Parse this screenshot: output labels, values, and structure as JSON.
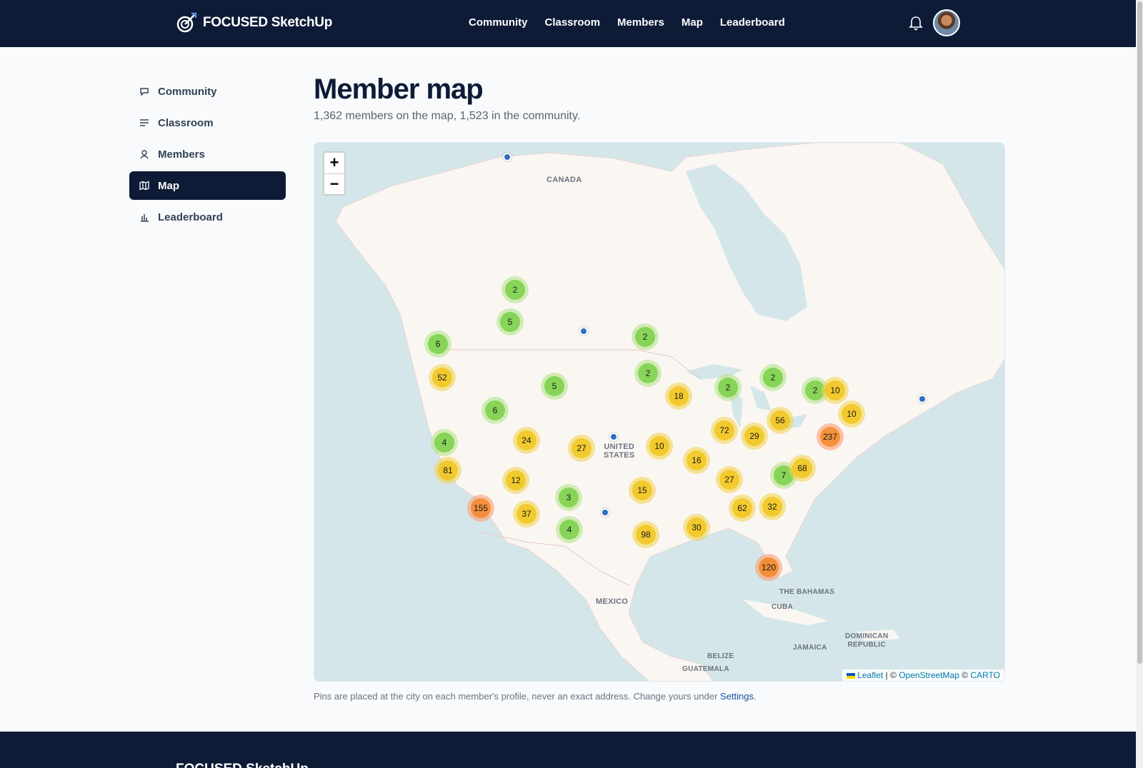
{
  "brand": {
    "name": "FOCUSED SketchUp"
  },
  "topnav": [
    "Community",
    "Classroom",
    "Members",
    "Map",
    "Leaderboard"
  ],
  "sidebar": {
    "items": [
      {
        "label": "Community",
        "icon": "chat-icon"
      },
      {
        "label": "Classroom",
        "icon": "list-icon"
      },
      {
        "label": "Members",
        "icon": "person-icon"
      },
      {
        "label": "Map",
        "icon": "map-icon",
        "active": true
      },
      {
        "label": "Leaderboard",
        "icon": "bar-chart-icon"
      }
    ]
  },
  "page": {
    "title": "Member map",
    "subtitle": "1,362 members on the map, 1,523 in the community."
  },
  "map": {
    "zoom_in": "+",
    "zoom_out": "−",
    "labels": {
      "canada": "CANADA",
      "us_line1": "UNITED",
      "us_line2": "STATES",
      "mexico": "MEXICO",
      "bahamas": "THE BAHAMAS",
      "cuba": "CUBA",
      "jamaica": "JAMAICA",
      "dr_line1": "DOMINICAN",
      "dr_line2": "REPUBLIC",
      "belize": "BELIZE",
      "guatemala": "GUATEMALA"
    },
    "clusters": [
      "2",
      "5",
      "6",
      "2",
      "52",
      "2",
      "5",
      "18",
      "2",
      "2",
      "2",
      "10",
      "6",
      "10",
      "4",
      "24",
      "27",
      "10",
      "72",
      "29",
      "56",
      "237",
      "16",
      "81",
      "12",
      "27",
      "7",
      "68",
      "15",
      "3",
      "155",
      "37",
      "62",
      "32",
      "4",
      "98",
      "30",
      "120"
    ],
    "attribution": {
      "leaflet": "Leaflet",
      "sep1": " | © ",
      "osm": "OpenStreetMap",
      "sep2": " © ",
      "carto": "CARTO"
    }
  },
  "footnote": {
    "text": "Pins are placed at the city on each member's profile, never an exact address. Change yours under ",
    "link": "Settings",
    "end": "."
  },
  "colors": {
    "navy": "#0d1b36",
    "pin": "#2f6dbf"
  }
}
